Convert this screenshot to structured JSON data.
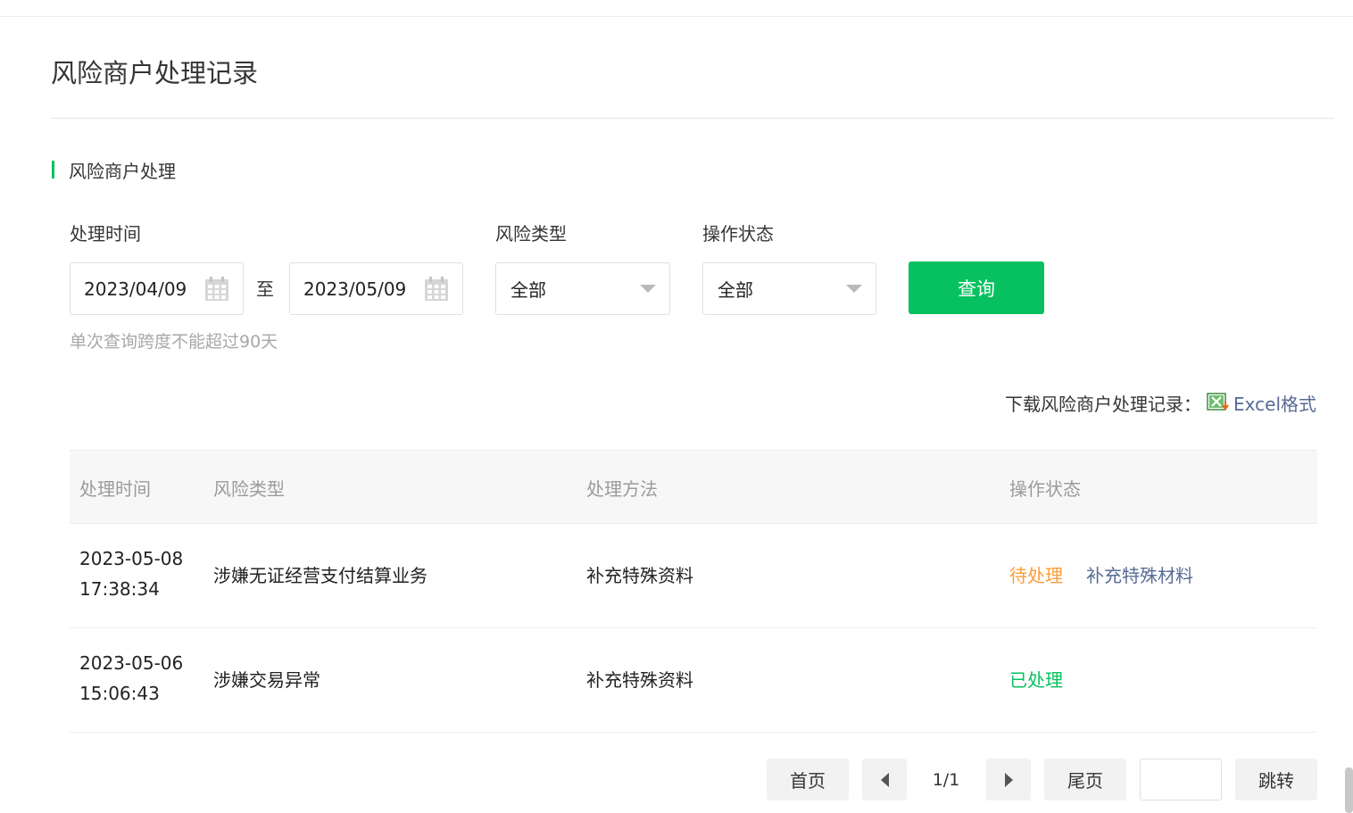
{
  "page": {
    "title": "风险商户处理记录"
  },
  "section": {
    "title": "风险商户处理"
  },
  "filters": {
    "time_label": "处理时间",
    "start_date": "2023/04/09",
    "range_separator": "至",
    "end_date": "2023/05/09",
    "risk_type_label": "风险类型",
    "risk_type_value": "全部",
    "status_label": "操作状态",
    "status_value": "全部",
    "query_button": "查询",
    "hint": "单次查询跨度不能超过90天"
  },
  "download": {
    "label": "下载风险商户处理记录：",
    "link": "Excel格式",
    "icon": "excel-icon"
  },
  "table": {
    "headers": [
      "处理时间",
      "风险类型",
      "处理方法",
      "操作状态"
    ],
    "rows": [
      {
        "time": "2023-05-08 17:38:34",
        "risk_type": "涉嫌无证经营支付结算业务",
        "method": "补充特殊资料",
        "status": "待处理",
        "action": "补充特殊材料"
      },
      {
        "time": "2023-05-06 15:06:43",
        "risk_type": "涉嫌交易异常",
        "method": "补充特殊资料",
        "status": "已处理",
        "action": ""
      }
    ]
  },
  "pagination": {
    "first": "首页",
    "indicator": "1/1",
    "last": "尾页",
    "jump_input": "",
    "jump": "跳转"
  },
  "colors": {
    "accent": "#07c160",
    "pending": "#fa9d3b",
    "link": "#576b95"
  }
}
